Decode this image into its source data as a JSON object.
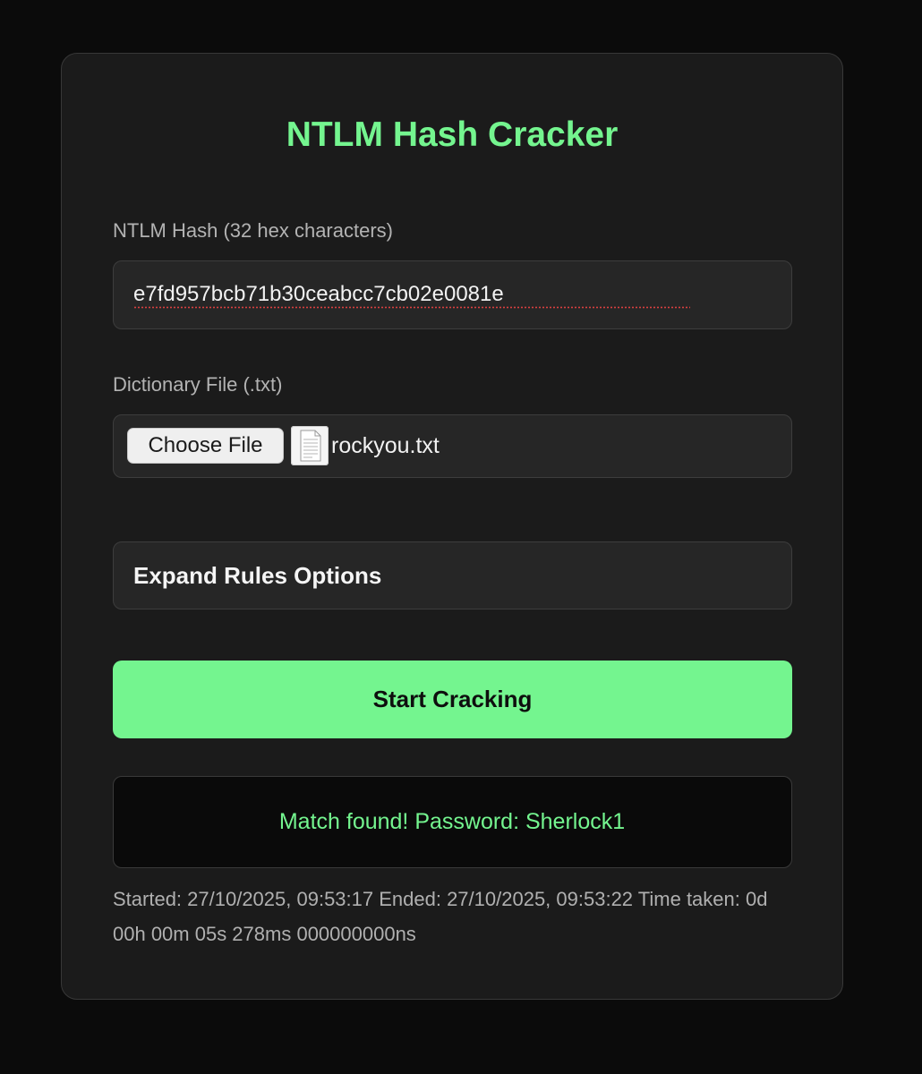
{
  "app": {
    "title": "NTLM Hash Cracker"
  },
  "hash_field": {
    "label": "NTLM Hash (32 hex characters)",
    "value": "e7fd957bcb71b30ceabcc7cb02e0081e"
  },
  "dictionary_field": {
    "label": "Dictionary File (.txt)",
    "button_label": "Choose File",
    "file_name": "rockyou.txt",
    "file_icon": "document-icon"
  },
  "rules": {
    "label": "Expand Rules Options"
  },
  "actions": {
    "start_label": "Start Cracking"
  },
  "result": {
    "message": "Match found! Password: Sherlock1"
  },
  "timing": {
    "text": "Started: 27/10/2025, 09:53:17 Ended: 27/10/2025, 09:53:22 Time taken: 0d 00h 00m 05s 278ms 000000000ns"
  },
  "colors": {
    "accent": "#74f58f",
    "background": "#0b0b0b",
    "card": "#1b1b1b",
    "field": "#262626"
  }
}
